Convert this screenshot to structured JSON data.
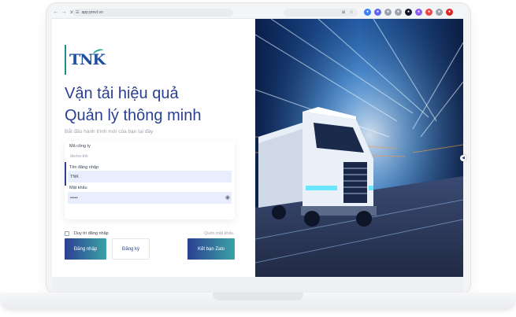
{
  "browser": {
    "url": "app.pmvt.vn",
    "nav_back": "←",
    "nav_forward": "→",
    "nav_close": "✕",
    "extensions": [
      "search-icon",
      "star-icon",
      "puzzle-icon",
      "profile-icon"
    ]
  },
  "logo": {
    "text": "TNK",
    "tagline": ""
  },
  "hero": {
    "line1": "Vận tải hiệu quả",
    "line2": "Quản lý thông minh",
    "subtitle": "Bắt đầu hành trình mới của bạn tại đây"
  },
  "form": {
    "company_label": "Mã công ty",
    "company_value": "demo-tnk",
    "username_label": "Tên đăng nhập",
    "username_value": "TNK",
    "password_label": "Mật khẩu",
    "password_value": "•••••"
  },
  "options": {
    "remember_label": "Duy trì đăng nhập",
    "forgot_label": "Quên mật khẩu"
  },
  "buttons": {
    "login": "Đăng nhập",
    "register": "Đăng ký",
    "zalo": "Kết bạn Zalo"
  },
  "colors": {
    "brand": "#2a3f8f",
    "accent": "#3aa3a6"
  }
}
